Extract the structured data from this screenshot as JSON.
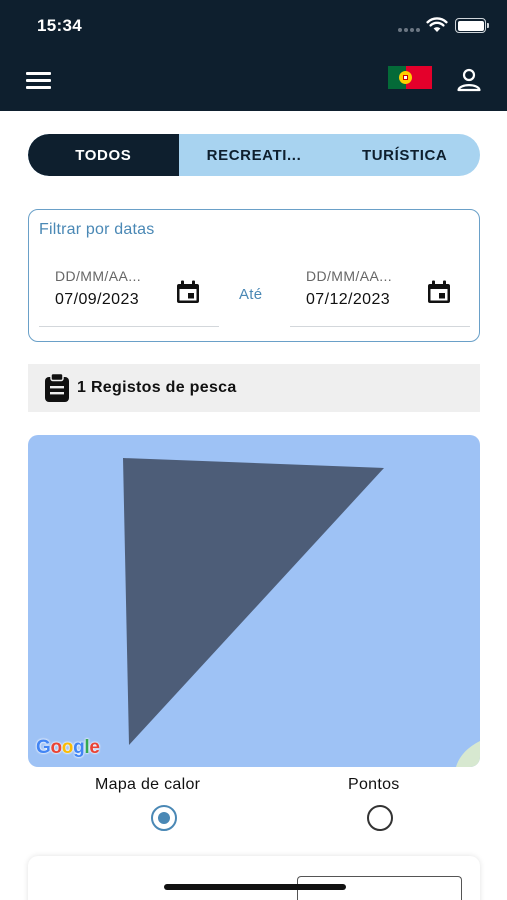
{
  "status_bar": {
    "time": "15:34"
  },
  "app_bar": {
    "menu_icon": "hamburger-menu-icon",
    "flag_icon": "portugal-flag-icon",
    "profile_icon": "user-profile-icon"
  },
  "tabs": [
    {
      "label": "TODOS",
      "active": true
    },
    {
      "label": "RECREATI...",
      "active": false
    },
    {
      "label": "TURÍSTICA",
      "active": false
    }
  ],
  "date_filter": {
    "title": "Filtrar por datas",
    "from": {
      "placeholder": "DD/MM/AA...",
      "value": "07/09/2023"
    },
    "separator": "Até",
    "to": {
      "placeholder": "DD/MM/AA...",
      "value": "07/12/2023"
    }
  },
  "records": {
    "label": "1 Registos de pesca",
    "icon": "clipboard-icon"
  },
  "map": {
    "logo": [
      "G",
      "o",
      "o",
      "g",
      "l",
      "e"
    ],
    "logo_colors": [
      "#4285F4",
      "#EA4335",
      "#FBBC05",
      "#4285F4",
      "#34A853",
      "#EA4335"
    ],
    "water_color": "#9ec2f5",
    "polygon_color": "#4d5d78"
  },
  "view_options": [
    {
      "label": "Mapa de calor",
      "selected": true
    },
    {
      "label": "Pontos",
      "selected": false
    }
  ],
  "colors": {
    "primary_dark": "#0e1f2e",
    "tab_bg": "#a8d3f0",
    "accent": "#4a88b5"
  }
}
